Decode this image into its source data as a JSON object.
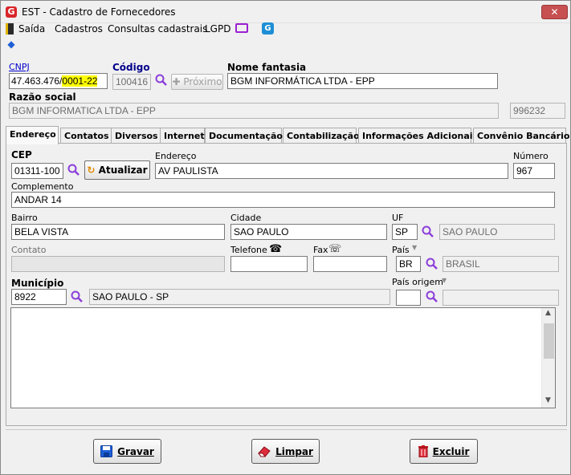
{
  "window": {
    "title": "EST - Cadastro de Fornecedores",
    "close_label": "✕"
  },
  "menu": {
    "items": [
      "Saída",
      "Cadastros",
      "Consultas cadastrais",
      "LGPD"
    ]
  },
  "header": {
    "cnpj_label": "CNPJ",
    "cnpj_value_prefix": "47.463.476/",
    "cnpj_value_suffix": "0001-22",
    "codigo_label": "Código",
    "codigo_value": "100416",
    "proximo_label": "Próximo",
    "nome_fantasia_label": "Nome fantasia",
    "nome_fantasia_value": "BGM INFORMÁTICA LTDA - EPP",
    "razao_social_label": "Razão social",
    "razao_social_value": "BGM INFORMATICA LTDA - EPP",
    "extra_value": "996232"
  },
  "tabs": [
    "Endereço",
    "Contatos",
    "Diversos",
    "Internet",
    "Documentação",
    "Contabilização",
    "Informações Adicionais",
    "Convênio Bancário"
  ],
  "address": {
    "cep_label": "CEP",
    "cep_value": "01311-100",
    "atualizar_label": "Atualizar",
    "endereco_label": "Endereço",
    "endereco_value": "AV PAULISTA",
    "numero_label": "Número",
    "numero_value": "967",
    "complemento_label": "Complemento",
    "complemento_value": "ANDAR 14",
    "bairro_label": "Bairro",
    "bairro_value": "BELA VISTA",
    "cidade_label": "Cidade",
    "cidade_value": "SAO PAULO",
    "uf_label": "UF",
    "uf_value": "SP",
    "uf_name": "SAO PAULO",
    "contato_label": "Contato",
    "contato_value": "",
    "telefone_label": "Telefone",
    "telefone_value": "",
    "fax_label": "Fax",
    "fax_value": "",
    "pais_label": "País",
    "pais_value": "BR",
    "pais_name": "BRASIL",
    "municipio_label": "Município",
    "municipio_code": "8922",
    "municipio_name": "SAO PAULO - SP",
    "pais_origem_label": "País origem",
    "pais_origem_value": "",
    "pais_origem_name": ""
  },
  "buttons": {
    "gravar": "Gravar",
    "limpar": "Limpar",
    "excluir": "Excluir"
  },
  "colors": {
    "accent": "#8b3fd9",
    "highlight": "#ffff00",
    "link": "#0000cc"
  }
}
